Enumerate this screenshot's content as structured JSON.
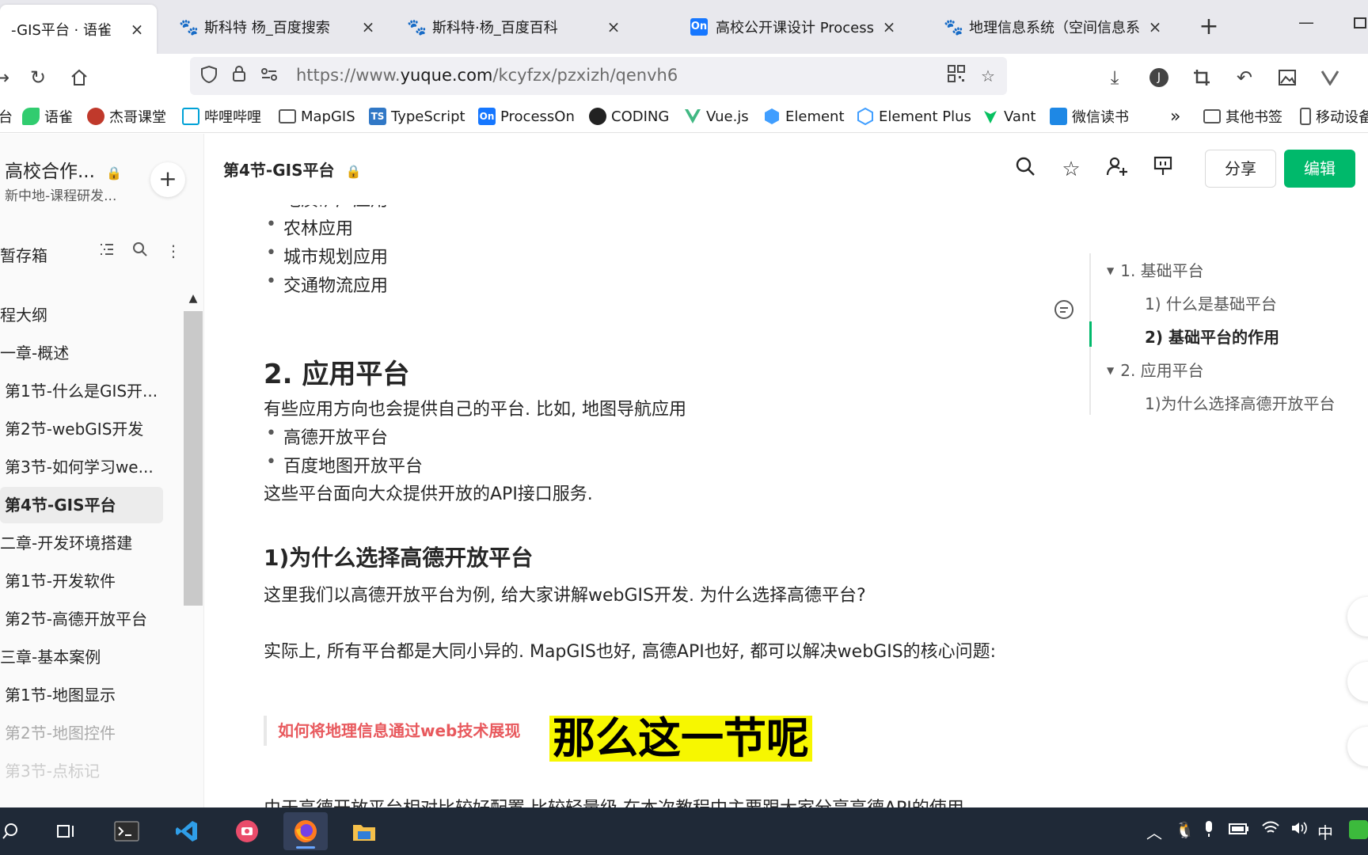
{
  "tabs": [
    {
      "label": "-GIS平台 · 语雀",
      "active": true,
      "icon": "yuque-icon"
    },
    {
      "label": "斯科特 杨_百度搜索",
      "active": false,
      "icon": "baidu-paw-icon"
    },
    {
      "label": "斯科特·杨_百度百科",
      "active": false,
      "icon": "baidu-paw-icon"
    },
    {
      "label": "高校公开课设计 ProcessOn",
      "active": false,
      "icon": "processon-icon"
    },
    {
      "label": "地理信息系统（空间信息系统",
      "active": false,
      "icon": "baidu-paw-icon"
    }
  ],
  "tab_close_glyph": "×",
  "new_tab_glyph": "+",
  "processon_badge": "On",
  "url": {
    "prefix": "https://www.",
    "host": "yuque.com",
    "path": "/kcyfzx/pzxizh/qenvh6"
  },
  "bookmarks": [
    {
      "label": "台",
      "icon": ""
    },
    {
      "label": "语雀",
      "icon": "yuque-icon",
      "color": "#31cc6f"
    },
    {
      "label": "杰哥课堂",
      "icon": "avatar-icon",
      "color": "#c0392b"
    },
    {
      "label": "哔哩哔哩",
      "icon": "bilibili-icon",
      "color": "#00a1d6"
    },
    {
      "label": "MapGIS",
      "icon": "folder-icon",
      "color": ""
    },
    {
      "label": "TypeScript",
      "icon": "typescript-icon",
      "color": "#3178c6",
      "badge": "TS"
    },
    {
      "label": "ProcessOn",
      "icon": "processon-icon",
      "color": "#1677ff",
      "badge": "On"
    },
    {
      "label": "CODING",
      "icon": "coding-icon",
      "color": "#222"
    },
    {
      "label": "Vue.js",
      "icon": "vue-icon",
      "color": "#41b883"
    },
    {
      "label": "Element",
      "icon": "element-icon",
      "color": "#409eff"
    },
    {
      "label": "Element Plus",
      "icon": "element-plus-icon",
      "color": "#409eff"
    },
    {
      "label": "Vant",
      "icon": "vant-icon",
      "color": "#07c160"
    },
    {
      "label": "微信读书",
      "icon": "weread-icon",
      "color": "#1e88e5"
    }
  ],
  "bookmarks_more": "»",
  "bookmarks_other": "其他书签",
  "bookmarks_mobile": "移动设备",
  "sidebar": {
    "kb_title": "高校合作...",
    "kb_subtitle": "新中地-课程研发...",
    "add_glyph": "+",
    "draft_label": "暂存箱",
    "tree": [
      {
        "label": "程大纲",
        "level": 0,
        "state": ""
      },
      {
        "label": "一章-概述",
        "level": 0,
        "state": ""
      },
      {
        "label": "第1节-什么是GIS开...",
        "level": 1,
        "state": ""
      },
      {
        "label": "第2节-webGIS开发",
        "level": 1,
        "state": ""
      },
      {
        "label": "第3节-如何学习we...",
        "level": 1,
        "state": ""
      },
      {
        "label": "第4节-GIS平台",
        "level": 1,
        "state": "active"
      },
      {
        "label": "二章-开发环境搭建",
        "level": 0,
        "state": ""
      },
      {
        "label": "第1节-开发软件",
        "level": 1,
        "state": ""
      },
      {
        "label": "第2节-高德开放平台",
        "level": 1,
        "state": ""
      },
      {
        "label": "三章-基本案例",
        "level": 0,
        "state": ""
      },
      {
        "label": "第1节-地图显示",
        "level": 1,
        "state": ""
      },
      {
        "label": "第2节-地图控件",
        "level": 1,
        "state": "faded"
      },
      {
        "label": "第3节-点标记",
        "level": 1,
        "state": "fainter"
      }
    ]
  },
  "header": {
    "title": "第4节-GIS平台",
    "share_label": "分享",
    "edit_label": "编辑"
  },
  "doc": {
    "bullets_top": [
      "地质矿产应用",
      "农林应用",
      "城市规划应用",
      "交通物流应用"
    ],
    "h2": "2. 应用平台",
    "p1": "有些应用方向也会提供自己的平台. 比如, 地图导航应用",
    "bullets_mid": [
      "高德开放平台",
      "百度地图开放平台"
    ],
    "p2": "这些平台面向大众提供开放的API接口服务.",
    "h3": "1)为什么选择高德开放平台",
    "p3": "这里我们以高德开放平台为例, 给大家讲解webGIS开发. 为什么选择高德平台?",
    "p4": "实际上, 所有平台都是大同小异的. MapGIS也好, 高德API也好, 都可以解决webGIS的核心问题:",
    "quote": "如何将地理信息通过web技术展现",
    "caption": "那么这一节呢",
    "p5": "由于高德开放平台相对比较好配置 比较轻量级 在本次教程中主要跟大家分享高德API的使用"
  },
  "toc": [
    {
      "label": "1. 基础平台",
      "level": 0,
      "state": ""
    },
    {
      "label": "1) 什么是基础平台",
      "level": 1,
      "state": ""
    },
    {
      "label": "2) 基础平台的作用",
      "level": 1,
      "state": "current"
    },
    {
      "label": "2. 应用平台",
      "level": 0,
      "state": ""
    },
    {
      "label": "1)为什么选择高德开放平台",
      "level": 1,
      "state": ""
    }
  ],
  "colors": {
    "accent_green": "#00b96b",
    "quote_red": "#e8595d",
    "caption_bg": "#f7f700"
  },
  "taskbar": {
    "apps": [
      "search-icon",
      "task-view-icon",
      "terminal-icon",
      "vscode-icon",
      "screen-recorder-icon",
      "firefox-icon",
      "file-explorer-icon"
    ],
    "ime": "中"
  }
}
